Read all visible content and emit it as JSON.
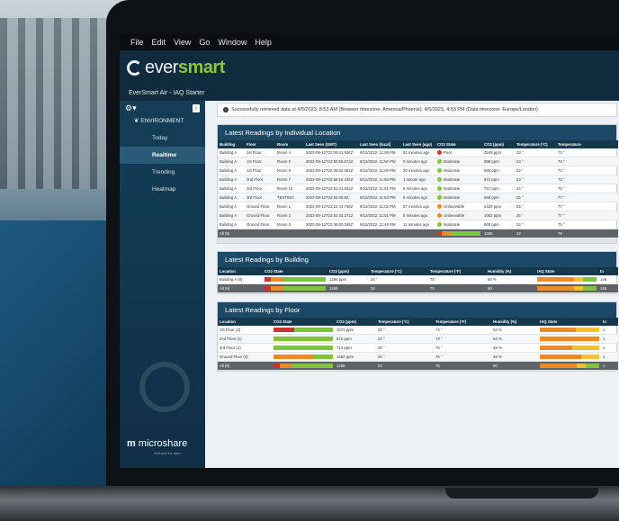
{
  "menu": [
    "File",
    "Edit",
    "View",
    "Go",
    "Window",
    "Help"
  ],
  "logo": {
    "ever": "ever",
    "smart": "smart"
  },
  "app_title": "EverSmart Air - IAQ Starter",
  "sidebar": {
    "section": "ENVIRONMENT",
    "items": [
      {
        "label": "Today",
        "active": false
      },
      {
        "label": "Realtime",
        "active": true
      },
      {
        "label": "Trending",
        "active": false
      },
      {
        "label": "Heatmap",
        "active": false
      }
    ],
    "brand": "microshare",
    "brand_sub": "unleash the data"
  },
  "alert": "Successfully retrieved data at 4/5/2023, 8:53 AM (Browser timezone: America/Phoenix). 4/5/2023, 4:53 PM (Data timezone: Europe/London)",
  "colors": {
    "poor": "#d0312d",
    "moderate": "#7fc43b",
    "unfavorable": "#f08a24",
    "gray": "#5e6368"
  },
  "individual": {
    "title": "Latest Readings by Individual Location",
    "columns": [
      "Building",
      "Floor",
      "Room",
      "Last Seen (GMT)",
      "Last Seen (local)",
      "Last Seen (ago)",
      "CO2 State",
      "CO2 (ppm)",
      "Temperature (°C)",
      "Temperature"
    ],
    "rows": [
      [
        "Building A",
        "1st Floor",
        "Room 4",
        "2022-09-12T22:08:41.934Z",
        "9/12/2022, 11:08 PM",
        "51 minutes ago",
        "Poor",
        "2949 ppm",
        "23 °",
        "73 °"
      ],
      [
        "Building A",
        "1st Floor",
        "Room 5",
        "2022-09-12T22:50:58.872Z",
        "9/12/2022, 11:50 PM",
        "9 minutes ago",
        "Moderate",
        "888 ppm",
        "23 °",
        "73 °"
      ],
      [
        "Building A",
        "1st Floor",
        "Room 6",
        "2022-09-12T22:39:32.082Z",
        "9/12/2022, 11:09 PM",
        "20 minutes ago",
        "Moderate",
        "890 ppm",
        "23 °",
        "73 °"
      ],
      [
        "Building A",
        "2nd Floor",
        "Room 7",
        "2022-09-12T22:58:16.432Z",
        "9/12/2022, 11:58 PM",
        "1 minute ago",
        "Moderate",
        "872 ppm",
        "23 °",
        "73 °"
      ],
      [
        "Building A",
        "3rd Floor",
        "Room 10",
        "2022-09-12T22:51:41.822Z",
        "9/12/2022, 11:51 PM",
        "8 minutes ago",
        "Moderate",
        "757 ppm",
        "24 °",
        "75 °"
      ],
      [
        "Building A",
        "3rd Floor",
        "TESTING",
        "2022-09-12T22:53:08.82",
        "9/12/2022, 11:53 PM",
        "6 minutes ago",
        "Moderate",
        "668 ppm",
        "25 °",
        "77 °"
      ],
      [
        "Building A",
        "Ground Floor",
        "Room 1",
        "2022-09-12T22:22:44.748Z",
        "9/12/2022, 11:02 PM",
        "57 minutes ago",
        "Unfavorable",
        "2429 ppm",
        "25 °",
        "77 °"
      ],
      [
        "Building A",
        "Ground Floor",
        "Room 2",
        "2022-09-12T22:51:43.271Z",
        "9/12/2022, 11:51 PM",
        "8 minutes ago",
        "Unfavorable",
        "1052 ppm",
        "25 °",
        "77 °"
      ],
      [
        "Building A",
        "Ground Floor",
        "Room 3",
        "2022-09-12T22:48:00.185Z",
        "9/12/2022, 11:48 PM",
        "11 minutes ago",
        "Moderate",
        "900 ppm",
        "24 °",
        "75 °"
      ]
    ],
    "all_row": {
      "label": "All (9)",
      "co2": "1265",
      "tc": "24",
      "tf": "75"
    }
  },
  "building": {
    "title": "Latest Readings by Building",
    "columns": [
      "Location",
      "CO2 State",
      "CO2 (ppm)",
      "Temperature (°C)",
      "Temperature (°F)",
      "Humidity (%)",
      "IAQ State",
      "In"
    ],
    "rows": [
      {
        "loc": "Building A (9)",
        "co2": "1265 ppm",
        "tc": "24 °",
        "tf": "75 °",
        "hum": "50 %",
        "in": "146"
      }
    ],
    "all_row": {
      "loc": "All (9)",
      "co2": "1265",
      "tc": "24",
      "tf": "75",
      "hum": "50",
      "in": "146"
    }
  },
  "floor": {
    "title": "Latest Readings by Floor",
    "columns": [
      "Location",
      "CO2 State",
      "CO2 (ppm)",
      "Temperature (°C)",
      "Temperature (°F)",
      "Humidity (%)",
      "IAQ State",
      "In"
    ],
    "rows": [
      {
        "loc": "1st Floor (3)",
        "co2": "1573 ppm",
        "tc": "23 °",
        "tf": "74 °",
        "hum": "53 %",
        "in": "1"
      },
      {
        "loc": "2nd Floor (1)",
        "co2": "872 ppm",
        "tc": "23 °",
        "tf": "73 °",
        "hum": "53 %",
        "in": "1"
      },
      {
        "loc": "3rd Floor (2)",
        "co2": "713 ppm",
        "tc": "25 °",
        "tf": "76 °",
        "hum": "48 %",
        "in": "1"
      },
      {
        "loc": "Ground Floor (3)",
        "co2": "1454 ppm",
        "tc": "25 °",
        "tf": "76 °",
        "hum": "48 %",
        "in": "1"
      }
    ],
    "all_row": {
      "loc": "All (9)",
      "co2": "1265",
      "tc": "24",
      "tf": "75",
      "hum": "50",
      "in": "1"
    }
  }
}
